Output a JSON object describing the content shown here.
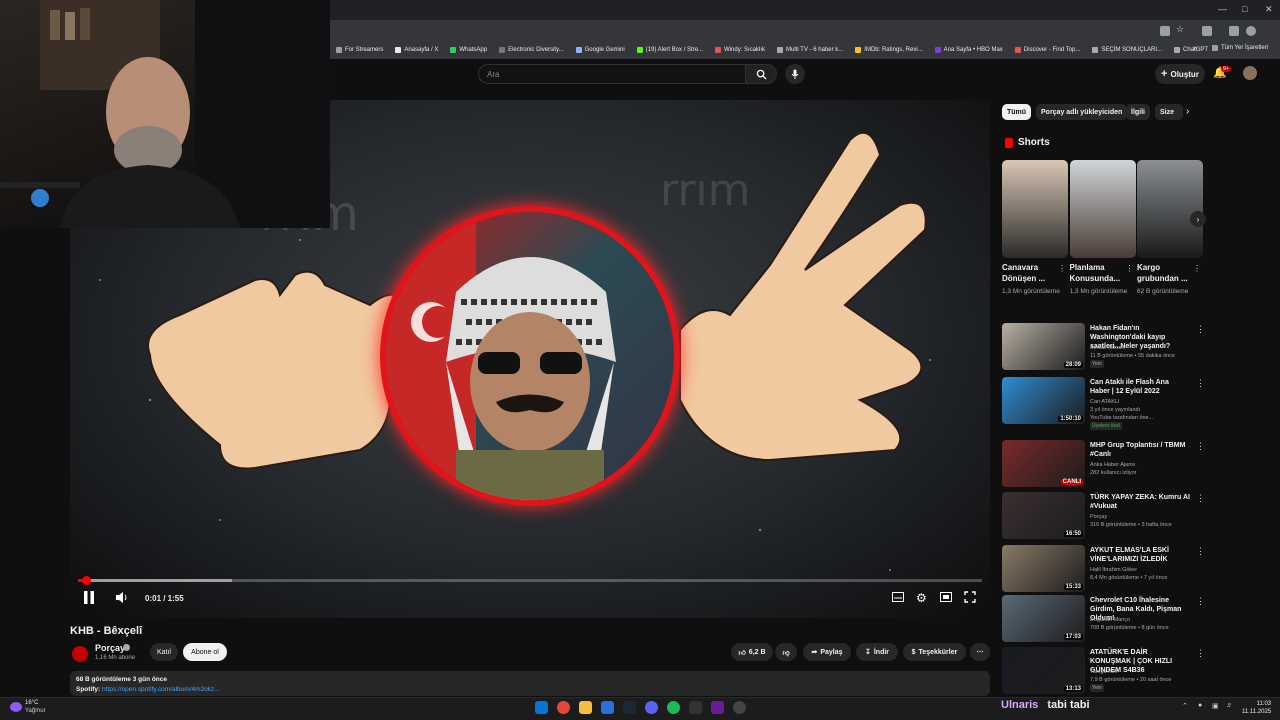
{
  "bookmarks": [
    "For Streamers",
    "Anasayfa / X",
    "WhatsApp",
    "Electronic Diversity...",
    "Google Gemini",
    "(19) Alert Box / Stre...",
    "Windy: Sıcaklık",
    "Multi TV - 6 haber k...",
    "IMDb: Ratings, Revi...",
    "Ana Sayfa • HBO Max",
    "Discover - Find Top...",
    "SEÇİM SONUÇLARI...",
    "ChatGPT"
  ],
  "all_bookmarks_label": "Tüm Yer İşaretleri",
  "header": {
    "search_placeholder": "Ara",
    "create_label": "Oluştur",
    "notification_count": "9+"
  },
  "player": {
    "time": "0:01 / 1:55",
    "progress_fraction": 0.009,
    "buffer_fraction": 0.17
  },
  "video": {
    "title": "KHB - Bêxçelî",
    "channel": "Porçay",
    "subscribers": "1,16 Mn abone",
    "join_label": "Katıl",
    "subscribe_label": "Abone ol",
    "likes": "6,2 B",
    "share_label": "Paylaş",
    "download_label": "İndir",
    "thanks_label": "Teşekkürler",
    "views_date": "68 B görüntüleme  3 gün önce",
    "spotify_prefix": "Spotify:",
    "spotify_link": "https://open.spotify.com/album/4m2okz..."
  },
  "chips": [
    "Tümü",
    "Porçay adlı yükleyiciden",
    "İlgili",
    "Size"
  ],
  "shorts": {
    "title": "Shorts",
    "items": [
      {
        "title": "Canavara Dönüşen ...",
        "views": "1,3 Mn görüntüleme",
        "color_a": "#d9c7b5",
        "color_b": "#2a2a2a"
      },
      {
        "title": "Planlama Konusunda...",
        "views": "1,3 Mn görüntüleme",
        "color_a": "#cfd6d9",
        "color_b": "#4a3a33"
      },
      {
        "title": "Kargo grubundan ...",
        "views": "62 B görüntüleme",
        "color_a": "#8a8f93",
        "color_b": "#1a1a1a"
      }
    ]
  },
  "recommendations": [
    {
      "title": "Hakan Fidan'ın Washington'daki kayıp saatleri...Neler yaşandı?",
      "channel": "Serdar Akinan",
      "meta": "11 B görüntüleme • 55 dakika önce",
      "badge": "Yeni",
      "duration": "28:09",
      "color": "#b8b0a4"
    },
    {
      "title": "Can Ataklı ile Flash Ana Haber | 12 Eylül 2022",
      "channel": "Can ATAKLI",
      "meta": "3 yıl önce yayınlandı",
      "extra": "YouTube tarafından öne...",
      "badge": "Üyelere özel",
      "duration": "1:50:10",
      "color": "#2f8dd6"
    },
    {
      "title": "MHP Grup Toplantısı / TBMM #Canlı",
      "channel": "Anka Haber Ajansı",
      "meta": "282 kullanıcı izliyor",
      "badge": "",
      "duration": "CANLI",
      "color": "#7a2a2a"
    },
    {
      "title": "TÜRK YAPAY ZEKA: Kumru AI #Vukuat",
      "channel": "Porçay",
      "meta": "316 B görüntüleme • 3 hafta önce",
      "badge": "",
      "duration": "16:50",
      "color": "#3a3030"
    },
    {
      "title": "AYKUT ELMAS'LA ESKİ VİNE'LARIMIZI İZLEDİK",
      "channel": "Halil İbrahim Göker",
      "meta": "8,4 Mn görüntüleme • 7 yıl önce",
      "badge": "",
      "duration": "15:33",
      "color": "#8a7a66"
    },
    {
      "title": "Chevrolet C10 İhalesine Girdim, Bana Kaldı, Pişman Oldum!",
      "channel": "Doğukan Manço",
      "meta": "708 B görüntüleme • 8 gün önce",
      "badge": "",
      "duration": "17:03",
      "color": "#5a6a76"
    },
    {
      "title": "ATATÜRK'E DAİR KONUŞMAK | ÇOK HIZLI GÜNDEM S4B36",
      "channel": "TamgaTürk",
      "meta": "7,9 B görüntüleme • 20 saat önce",
      "badge": "Yeni",
      "duration": "13:13",
      "color": "#1a1a22"
    }
  ],
  "taskbar": {
    "temperature": "16°C",
    "condition": "Yağmur",
    "ticker_left": "Ulnaris",
    "ticker_right": "tabi tabi",
    "time": "11:03",
    "date": "11.11.2025"
  },
  "colors": {
    "accent": "#ff0000",
    "background": "#0f0f0f",
    "ring": "#e0151b"
  }
}
